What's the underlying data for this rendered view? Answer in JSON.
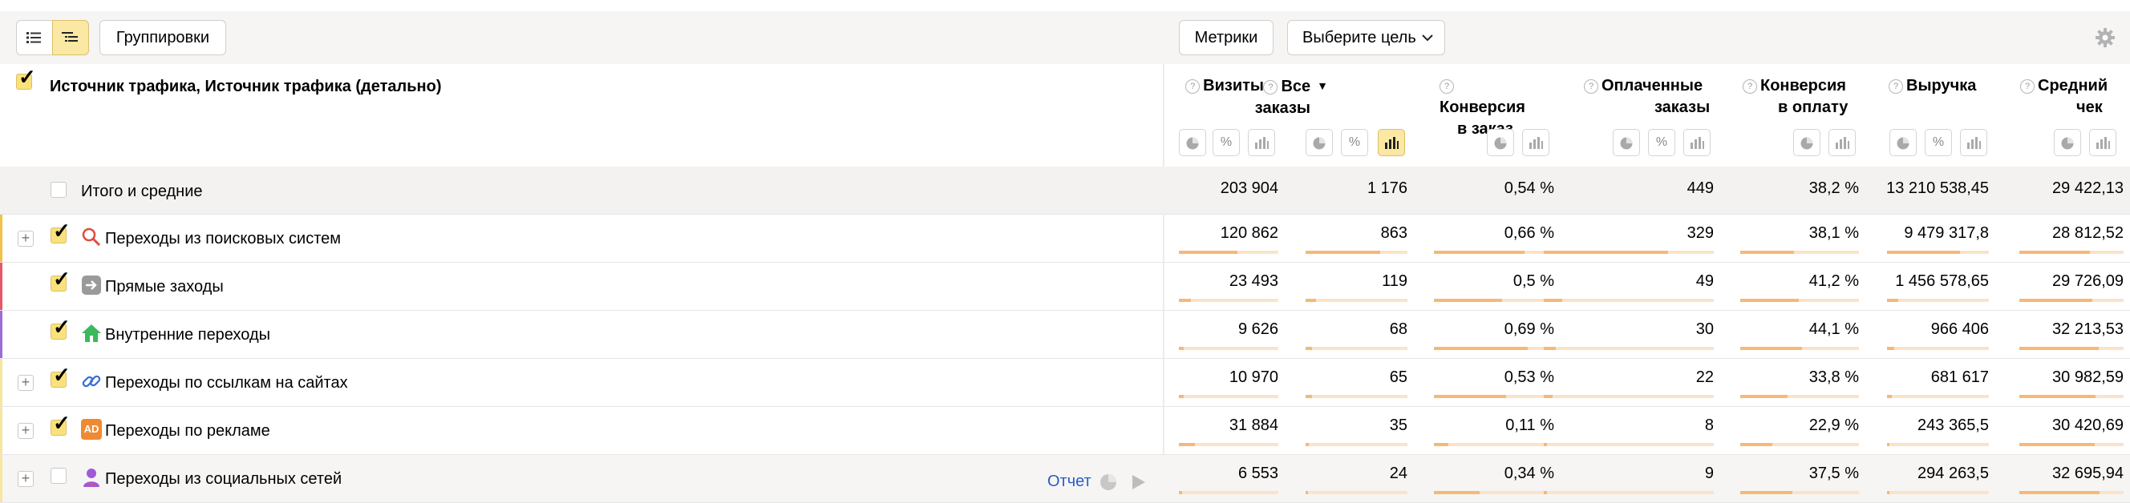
{
  "toolbar": {
    "groupings_label": "Группировки",
    "metrics_label": "Метрики",
    "goal_label": "Выберите цель"
  },
  "header": {
    "dimension_title": "Источник трафика, Источник трафика (детально)",
    "columns": [
      {
        "line1": "Визиты",
        "line2": ""
      },
      {
        "line1": "Все",
        "line2": "заказы",
        "sorted": "desc"
      },
      {
        "line1": "Конверсия",
        "line2": "в заказ"
      },
      {
        "line1": "Оплаченные",
        "line2": "заказы"
      },
      {
        "line1": "Конверсия",
        "line2": "в оплату"
      },
      {
        "line1": "Выручка",
        "line2": ""
      },
      {
        "line1": "Средний",
        "line2": "чек"
      }
    ],
    "help_glyph": "?",
    "sort_glyph": "▼",
    "percent_glyph": "%"
  },
  "totals": {
    "label": "Итого и средние",
    "values": [
      "203 904",
      "1 176",
      "0,54 %",
      "449",
      "38,2 %",
      "13 210 538,45",
      "29 422,13"
    ]
  },
  "rows": [
    {
      "label": "Переходы из поисковых систем",
      "icon": "search-icon",
      "expandable": true,
      "checked": true,
      "strip_color": "#f1c24a",
      "values": [
        "120 862",
        "863",
        "0,66 %",
        "329",
        "38,1 %",
        "9 479 317,8",
        "28 812,52"
      ],
      "bars": [
        0.59,
        0.73,
        0.75,
        0.73,
        0.45,
        0.72,
        0.68
      ]
    },
    {
      "label": "Прямые заходы",
      "icon": "arrow-right-icon",
      "expandable": false,
      "checked": true,
      "strip_color": "#e8566a",
      "values": [
        "23 493",
        "119",
        "0,5 %",
        "49",
        "41,2 %",
        "1 456 578,65",
        "29 726,09"
      ],
      "bars": [
        0.12,
        0.1,
        0.57,
        0.11,
        0.49,
        0.11,
        0.7
      ]
    },
    {
      "label": "Внутренние переходы",
      "icon": "home-icon",
      "expandable": false,
      "checked": true,
      "strip_color": "#9b6bd6",
      "values": [
        "9 626",
        "68",
        "0,69 %",
        "30",
        "44,1 %",
        "966 406",
        "32 213,53"
      ],
      "bars": [
        0.05,
        0.06,
        0.78,
        0.07,
        0.52,
        0.07,
        0.76
      ]
    },
    {
      "label": "Переходы по ссылкам на сайтах",
      "icon": "link-icon",
      "expandable": true,
      "checked": true,
      "strip_color": "#f6e6a0",
      "values": [
        "10 970",
        "65",
        "0,53 %",
        "22",
        "33,8 %",
        "681 617",
        "30 982,59"
      ],
      "bars": [
        0.05,
        0.06,
        0.6,
        0.05,
        0.4,
        0.05,
        0.73
      ]
    },
    {
      "label": "Переходы по рекламе",
      "icon": "ad-icon",
      "icon_text": "AD",
      "expandable": true,
      "checked": true,
      "strip_color": "#f6e6a0",
      "values": [
        "31 884",
        "35",
        "0,11 %",
        "8",
        "22,9 %",
        "243 365,5",
        "30 420,69"
      ],
      "bars": [
        0.16,
        0.03,
        0.12,
        0.02,
        0.27,
        0.02,
        0.72
      ]
    },
    {
      "label": "Переходы из социальных сетей",
      "icon": "social-person-icon",
      "expandable": true,
      "checked": false,
      "strip_color": "#f6e6a0",
      "values": [
        "6 553",
        "24",
        "0,34 %",
        "9",
        "37,5 %",
        "294 263,5",
        "32 695,94"
      ],
      "bars": [
        0.03,
        0.02,
        0.38,
        0.02,
        0.44,
        0.02,
        0.77
      ],
      "report_label": "Отчет"
    }
  ],
  "colors": {
    "accent_yellow": "#fae8a4",
    "bar_fill": "#f7b876",
    "bar_track": "#fbe3c9",
    "link_blue": "#2a5cc7"
  }
}
